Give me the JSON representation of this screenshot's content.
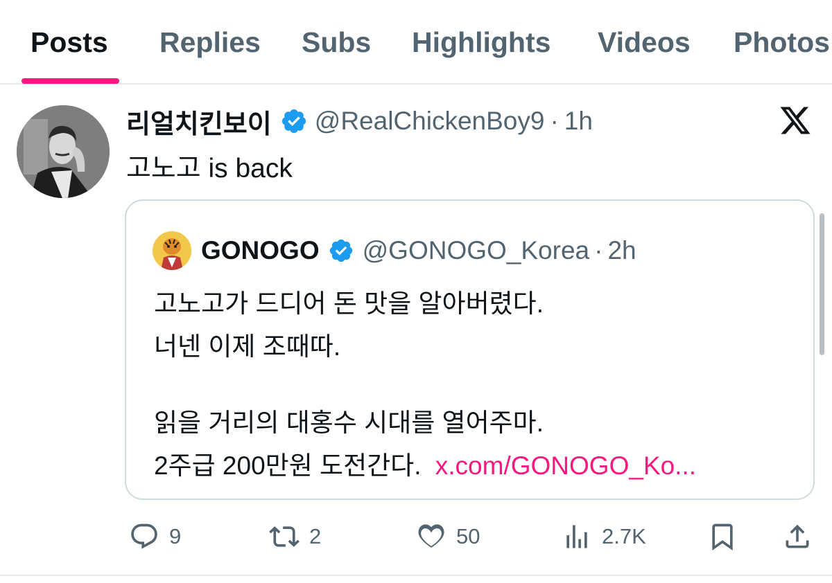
{
  "tabs": [
    {
      "label": "Posts",
      "active": true
    },
    {
      "label": "Replies",
      "active": false
    },
    {
      "label": "Subs",
      "active": false
    },
    {
      "label": "Highlights",
      "active": false
    },
    {
      "label": "Videos",
      "active": false
    },
    {
      "label": "Photos",
      "active": false
    }
  ],
  "accent_color": "#f91880",
  "verified_color": "#1d9bf0",
  "post": {
    "display_name": "리얼치킨보이",
    "handle": "@RealChickenBoy9",
    "separator": "·",
    "time": "1h",
    "text": "고노고 is back",
    "platform_icon": "x-logo-icon",
    "quote": {
      "display_name": "GONOGO",
      "handle": "@GONOGO_Korea",
      "separator": "·",
      "time": "2h",
      "lines": [
        "고노고가 드디어 돈 맛을 알아버렸다.",
        "너넨 이제 조때따.",
        "읽을 거리의 대홍수 시대를 열어주마.",
        "2주급 200만원 도전간다."
      ],
      "link": "x.com/GONOGO_Ko..."
    },
    "actions": {
      "replies": "9",
      "reposts": "2",
      "likes": "50",
      "views": "2.7K"
    }
  }
}
